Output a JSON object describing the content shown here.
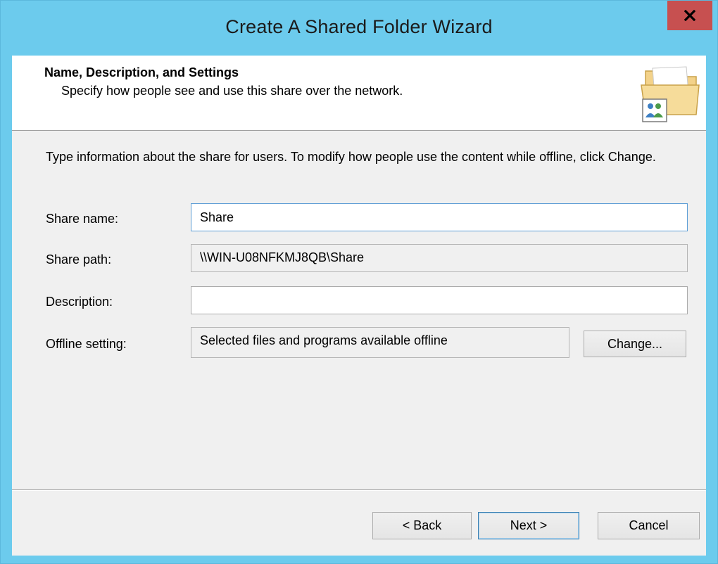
{
  "window": {
    "title": "Create A Shared Folder Wizard",
    "close_glyph": "x"
  },
  "header": {
    "title": "Name, Description, and Settings",
    "subtitle": "Specify how people see and use this share over the network.",
    "icon": "shared-folder-icon"
  },
  "intro": "Type information about the share for users. To modify how people use the content while offline, click Change.",
  "form": {
    "share_name": {
      "label": "Share name:",
      "value": "Share"
    },
    "share_path": {
      "label": "Share path:",
      "value": "\\\\WIN-U08NFKMJ8QB\\Share"
    },
    "description": {
      "label": "Description:",
      "value": ""
    },
    "offline_setting": {
      "label": "Offline setting:",
      "value": "Selected files and programs available offline",
      "change_label": "Change..."
    }
  },
  "buttons": {
    "back": "< Back",
    "next": "Next >",
    "cancel": "Cancel"
  },
  "colors": {
    "titlebar": "#6ccbed",
    "close": "#c75050",
    "client": "#f0f0f0"
  }
}
